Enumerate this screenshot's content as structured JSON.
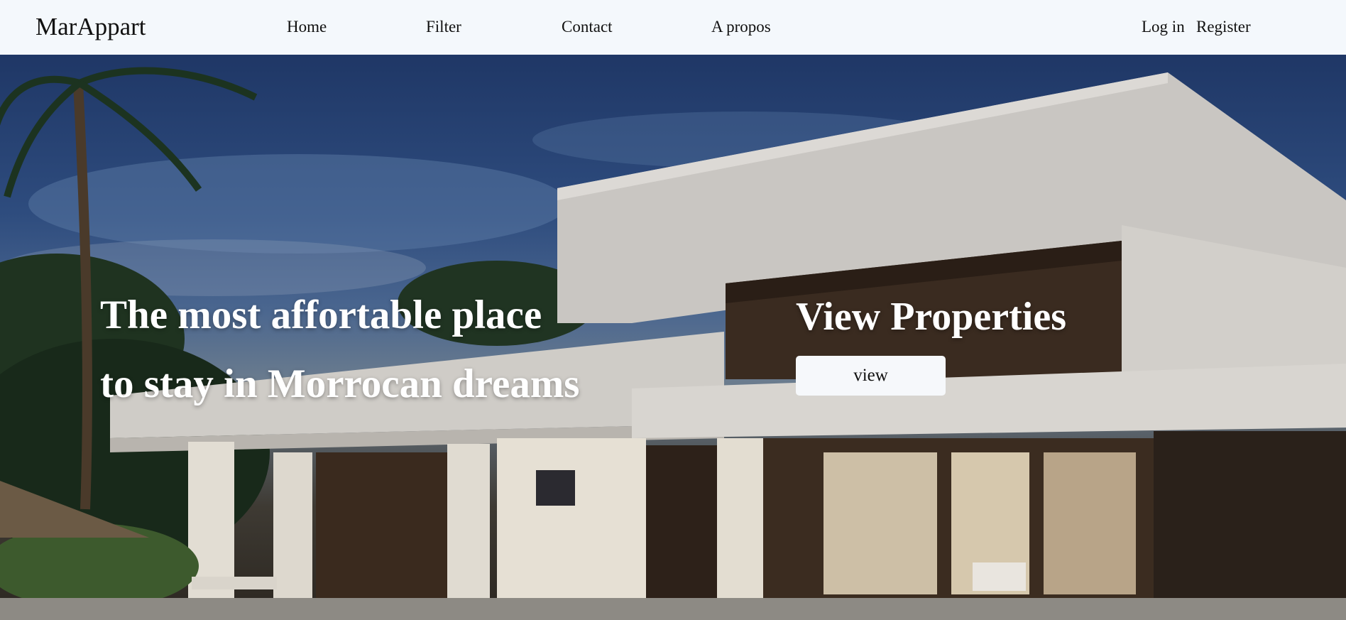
{
  "navbar": {
    "brand": "MarAppart",
    "links": [
      {
        "label": "Home"
      },
      {
        "label": "Filter"
      },
      {
        "label": "Contact"
      },
      {
        "label": "A propos"
      }
    ],
    "auth": {
      "login": "Log in",
      "register": "Register"
    }
  },
  "hero": {
    "headline": "The most affortable place\nto stay in Morrocan dreams",
    "cta_title": "View Properties",
    "cta_button": "view"
  },
  "colors": {
    "navbar_bg": "#f4f8fc",
    "hero_text": "#ffffff",
    "button_bg": "#f6f8fb"
  }
}
